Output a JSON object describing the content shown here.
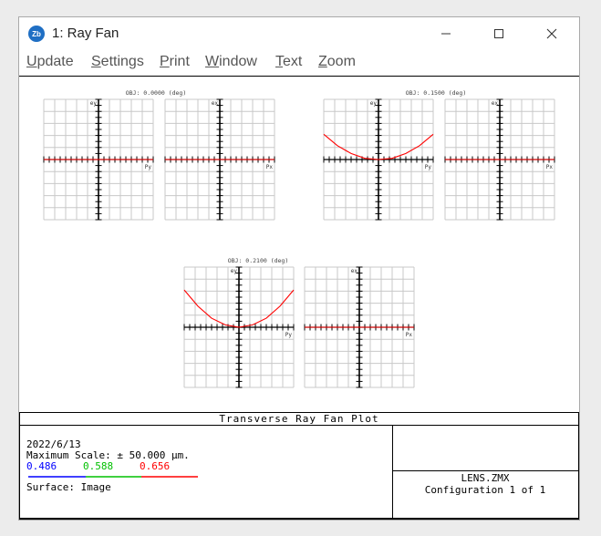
{
  "window": {
    "title": "1: Ray Fan",
    "app_icon_text": "Zb",
    "controls": [
      "minimize",
      "maximize",
      "close"
    ]
  },
  "menu": [
    {
      "accel": "U",
      "rest": "pdate"
    },
    {
      "accel": "S",
      "rest": "ettings"
    },
    {
      "accel": "P",
      "rest": "rint"
    },
    {
      "accel": "W",
      "rest": "indow"
    },
    {
      "accel": "T",
      "rest": "ext"
    },
    {
      "accel": "Z",
      "rest": "oom"
    }
  ],
  "fields": [
    {
      "title": "OBJ: 0.0000 (deg)"
    },
    {
      "title": "OBJ: 0.1500 (deg)"
    },
    {
      "title": "OBJ: 0.2100 (deg)"
    }
  ],
  "axis_labels": {
    "tangential_y": "ey",
    "tangential_x": "Py",
    "sagittal_y": "ex",
    "sagittal_x": "Px"
  },
  "footer": {
    "plot_title": "Transverse Ray Fan Plot",
    "date": "2022/6/13",
    "scale": "Maximum Scale: ± 50.000 μm.",
    "wavelengths": [
      {
        "label": "0.486",
        "color": "#0000ff"
      },
      {
        "label": "0.588",
        "color": "#00c000"
      },
      {
        "label": "0.656",
        "color": "#ff0000"
      }
    ],
    "surface": "Surface: Image",
    "lens_file": "LENS.ZMX",
    "configuration": "Configuration 1 of 1"
  },
  "chart_data": [
    {
      "type": "line",
      "title": "OBJ: 0.0000 (deg)",
      "xlabel": "Py",
      "ylabel": "ey",
      "xlim": [
        -1,
        1
      ],
      "ylim": [
        -1,
        1
      ],
      "grid": true,
      "series": [
        {
          "color": "#ff0000",
          "x": [
            -1,
            -0.5,
            0,
            0.5,
            1
          ],
          "y": [
            0,
            0,
            0,
            0,
            0
          ]
        }
      ]
    },
    {
      "type": "line",
      "title": "",
      "xlabel": "Px",
      "ylabel": "ex",
      "xlim": [
        -1,
        1
      ],
      "ylim": [
        -1,
        1
      ],
      "grid": true,
      "series": [
        {
          "color": "#ff0000",
          "x": [
            -1,
            -0.5,
            0,
            0.5,
            1
          ],
          "y": [
            0,
            0,
            0,
            0,
            0
          ]
        }
      ]
    },
    {
      "type": "line",
      "title": "OBJ: 0.1500 (deg)",
      "xlabel": "Py",
      "ylabel": "ey",
      "xlim": [
        -1,
        1
      ],
      "ylim": [
        -1,
        1
      ],
      "grid": true,
      "series": [
        {
          "color": "#ff0000",
          "x": [
            -1,
            -0.75,
            -0.5,
            -0.25,
            0,
            0.25,
            0.5,
            0.75,
            1
          ],
          "y": [
            0.42,
            0.23,
            0.1,
            0.02,
            0,
            0.02,
            0.1,
            0.23,
            0.42
          ]
        }
      ]
    },
    {
      "type": "line",
      "title": "",
      "xlabel": "Px",
      "ylabel": "ex",
      "xlim": [
        -1,
        1
      ],
      "ylim": [
        -1,
        1
      ],
      "grid": true,
      "series": [
        {
          "color": "#ff0000",
          "x": [
            -1,
            -0.5,
            0,
            0.5,
            1
          ],
          "y": [
            0,
            0,
            0,
            0,
            0
          ]
        }
      ]
    },
    {
      "type": "line",
      "title": "OBJ: 0.2100 (deg)",
      "xlabel": "Py",
      "ylabel": "ey",
      "xlim": [
        -1,
        1
      ],
      "ylim": [
        -1,
        1
      ],
      "grid": true,
      "series": [
        {
          "color": "#ff0000",
          "x": [
            -1,
            -0.75,
            -0.5,
            -0.25,
            0,
            0.25,
            0.5,
            0.75,
            1
          ],
          "y": [
            0.62,
            0.35,
            0.15,
            0.04,
            0,
            0.04,
            0.15,
            0.35,
            0.62
          ]
        }
      ]
    },
    {
      "type": "line",
      "title": "",
      "xlabel": "Px",
      "ylabel": "ex",
      "xlim": [
        -1,
        1
      ],
      "ylim": [
        -1,
        1
      ],
      "grid": true,
      "series": [
        {
          "color": "#ff0000",
          "x": [
            -1,
            -0.5,
            0,
            0.5,
            1
          ],
          "y": [
            0,
            0,
            0,
            0,
            0
          ]
        }
      ]
    }
  ]
}
